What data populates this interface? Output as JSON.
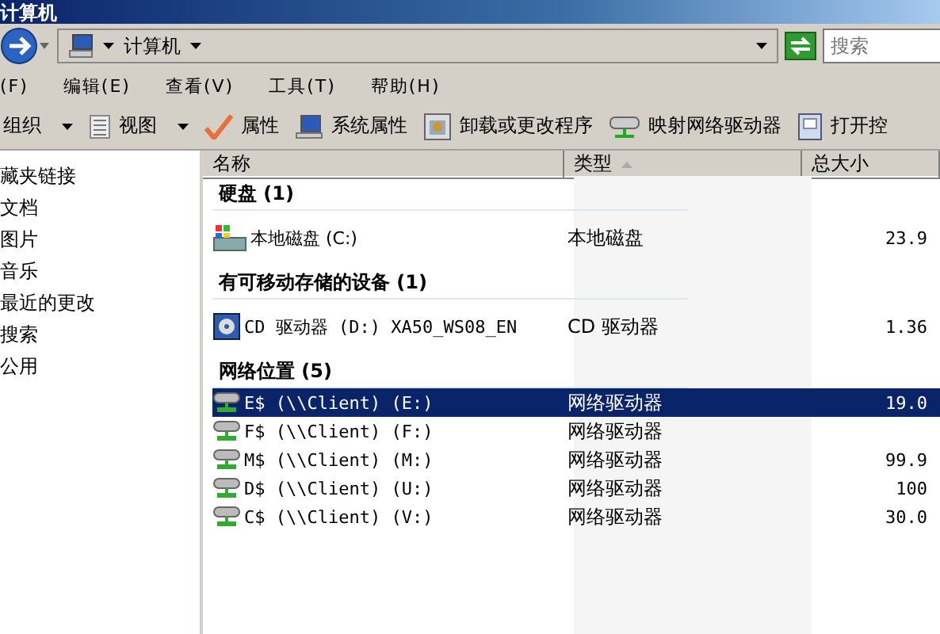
{
  "window": {
    "title": "计算机"
  },
  "address": {
    "path": "计算机",
    "search_placeholder": "搜索"
  },
  "menu": [
    "(F)",
    "编辑(E)",
    "查看(V)",
    "工具(T)",
    "帮助(H)"
  ],
  "toolbar": [
    {
      "label": "组织",
      "kind": "none",
      "dropdown": true
    },
    {
      "label": "视图",
      "kind": "view",
      "dropdown": true
    },
    {
      "label": "属性",
      "kind": "check",
      "dropdown": false
    },
    {
      "label": "系统属性",
      "kind": "computer",
      "dropdown": false
    },
    {
      "label": "卸载或更改程序",
      "kind": "program",
      "dropdown": false
    },
    {
      "label": "映射网络驱动器",
      "kind": "netdrive",
      "dropdown": false
    },
    {
      "label": "打开控",
      "kind": "panel",
      "dropdown": false
    }
  ],
  "sidebar": {
    "items": [
      "藏夹链接",
      "文档",
      "图片",
      "音乐",
      "最近的更改",
      "搜索",
      "公用"
    ]
  },
  "columns": [
    {
      "label": "名称",
      "sorted": false
    },
    {
      "label": "类型",
      "sorted": true
    },
    {
      "label": "总大小",
      "sorted": false
    }
  ],
  "groups": [
    {
      "title": "硬盘 (1)",
      "items": [
        {
          "name": "本地磁盘 (C:)",
          "type": "本地磁盘",
          "size": "23.9",
          "kind": "disk",
          "selected": false
        }
      ]
    },
    {
      "title": "有可移动存储的设备 (1)",
      "items": [
        {
          "name": "CD 驱动器 (D:) XA50_WS08_EN",
          "type": "CD 驱动器",
          "size": "1.36",
          "kind": "cd",
          "selected": false
        }
      ]
    },
    {
      "title": "网络位置 (5)",
      "items": [
        {
          "name": "E$ (\\\\Client) (E:)",
          "type": "网络驱动器",
          "size": "19.0",
          "kind": "net",
          "selected": true
        },
        {
          "name": "F$ (\\\\Client) (F:)",
          "type": "网络驱动器",
          "kind": "net",
          "selected": false
        },
        {
          "name": "M$ (\\\\Client) (M:)",
          "type": "网络驱动器",
          "size": "99.9",
          "kind": "net",
          "selected": false
        },
        {
          "name": "D$ (\\\\Client) (U:)",
          "type": "网络驱动器",
          "size": "100",
          "kind": "net",
          "selected": false
        },
        {
          "name": "C$ (\\\\Client) (V:)",
          "type": "网络驱动器",
          "size": "30.0",
          "kind": "net",
          "selected": false
        }
      ]
    }
  ]
}
